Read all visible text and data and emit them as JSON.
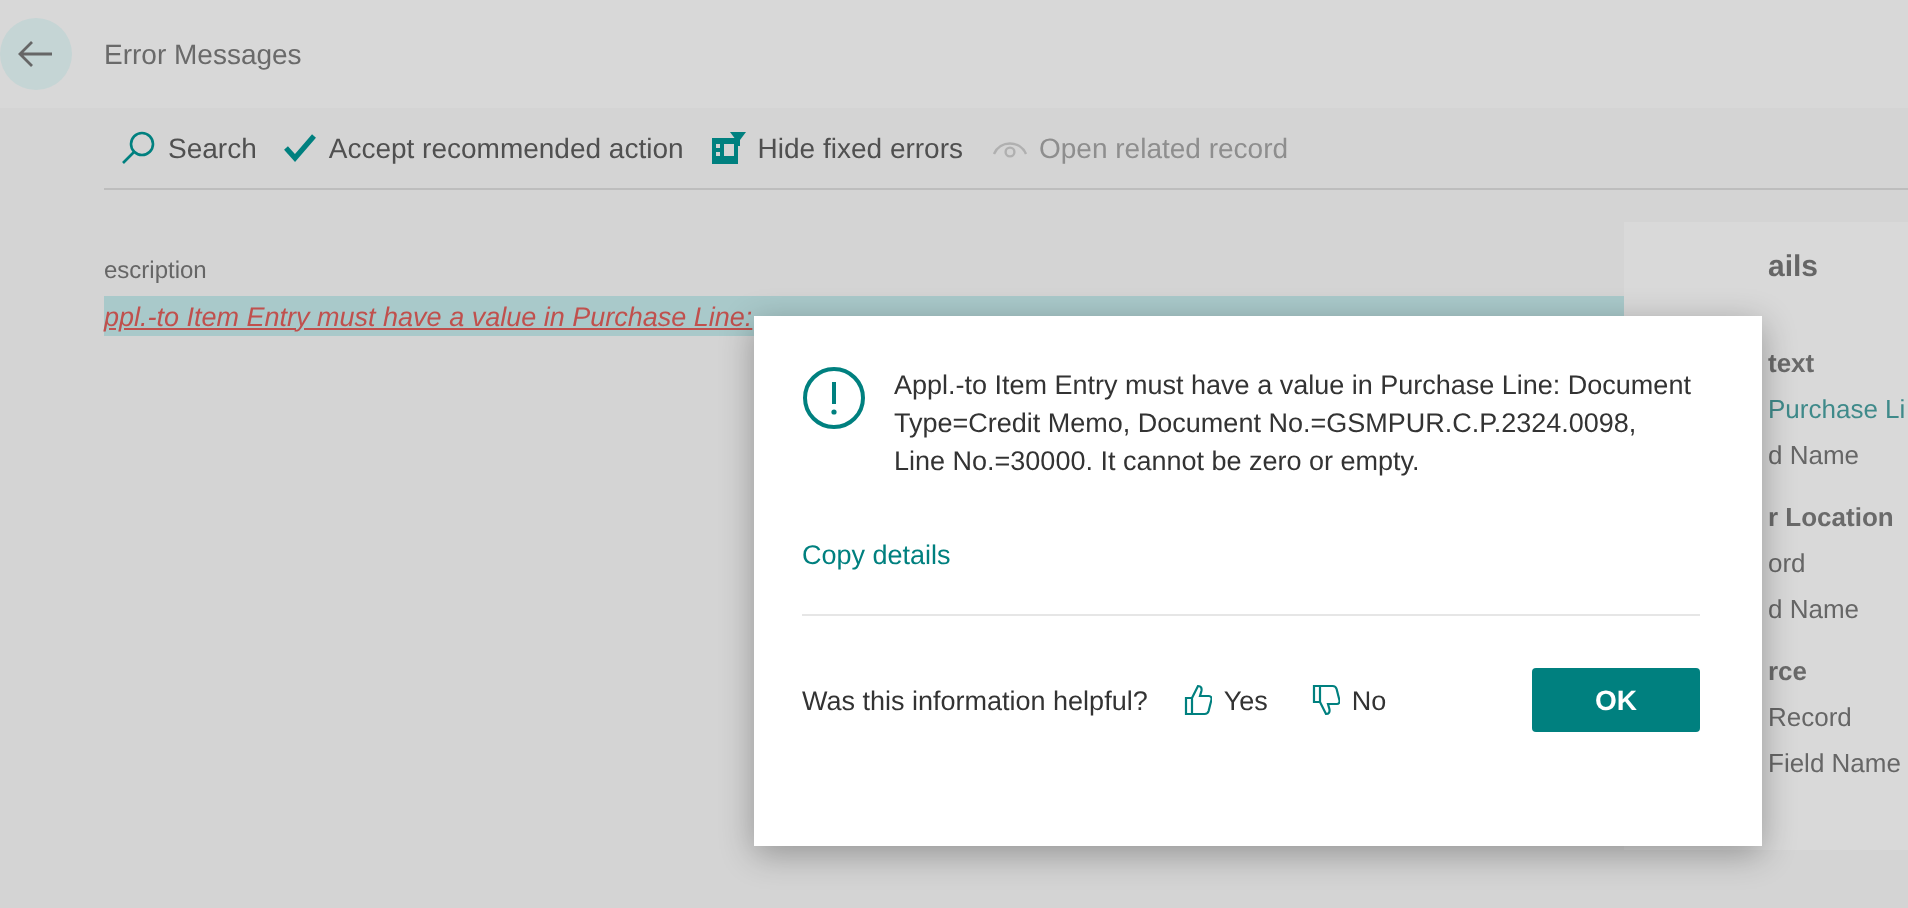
{
  "page": {
    "title": "Error Messages"
  },
  "toolbar": [
    {
      "kind": "search",
      "label": "Search",
      "disabled": false
    },
    {
      "kind": "accept",
      "label": "Accept recommended action",
      "disabled": false
    },
    {
      "kind": "filter",
      "label": "Hide fixed errors",
      "disabled": false
    },
    {
      "kind": "open",
      "label": "Open related record",
      "disabled": true
    }
  ],
  "table": {
    "columns": [
      "escription"
    ],
    "rows": [
      {
        "text": "ppl.-to Item Entry must have a value in Purchase Line:",
        "selected": true
      }
    ]
  },
  "details": [
    {
      "kind": "heading",
      "text": "ails"
    },
    {
      "kind": "label",
      "text": "text"
    },
    {
      "kind": "link",
      "text": "Purchase Li"
    },
    {
      "kind": "value",
      "text": "d Name"
    },
    {
      "kind": "label",
      "text": "r Location"
    },
    {
      "kind": "value",
      "text": "ord"
    },
    {
      "kind": "value",
      "text": "d Name"
    },
    {
      "kind": "label",
      "text": "rce"
    },
    {
      "kind": "value",
      "text": "Record"
    },
    {
      "kind": "value",
      "text": "Field Name"
    }
  ],
  "dialog": {
    "message": "Appl.-to Item Entry must have a value in Purchase Line: Document Type=Credit Memo, Document No.=GSMPUR.C.P.2324.0098, Line No.=30000. It cannot be zero or empty.",
    "copy_link": "Copy details",
    "feedback_question": "Was this information helpful?",
    "yes": "Yes",
    "no": "No",
    "ok": "OK"
  }
}
